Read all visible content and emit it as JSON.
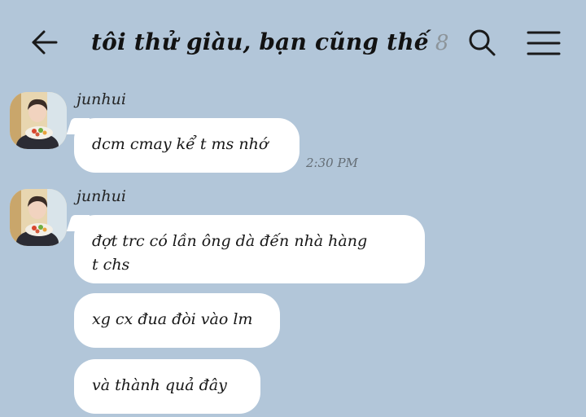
{
  "header": {
    "title": "tôi thử giàu, bạn cũng thế",
    "member_count": "8",
    "back_icon": "arrow-left-icon",
    "search_icon": "search-icon",
    "menu_icon": "hamburger-menu-icon"
  },
  "messages": [
    {
      "sender": "junhui",
      "bubbles": [
        {
          "lines": [
            "dcm cmay kể t ms nhớ"
          ]
        }
      ],
      "time": "2:30 PM"
    },
    {
      "sender": "junhui",
      "bubbles": [
        {
          "lines": [
            "đợt trc có lần ông dà đến nhà hàng",
            "t chs"
          ]
        },
        {
          "lines": [
            "xg cx đua đòi vào lm"
          ]
        },
        {
          "lines": [
            "và thành quả đây"
          ]
        }
      ]
    }
  ],
  "colors": {
    "background": "#b2c6d9",
    "bubble": "#ffffff",
    "text": "#171717",
    "timestamp": "#646d75"
  }
}
